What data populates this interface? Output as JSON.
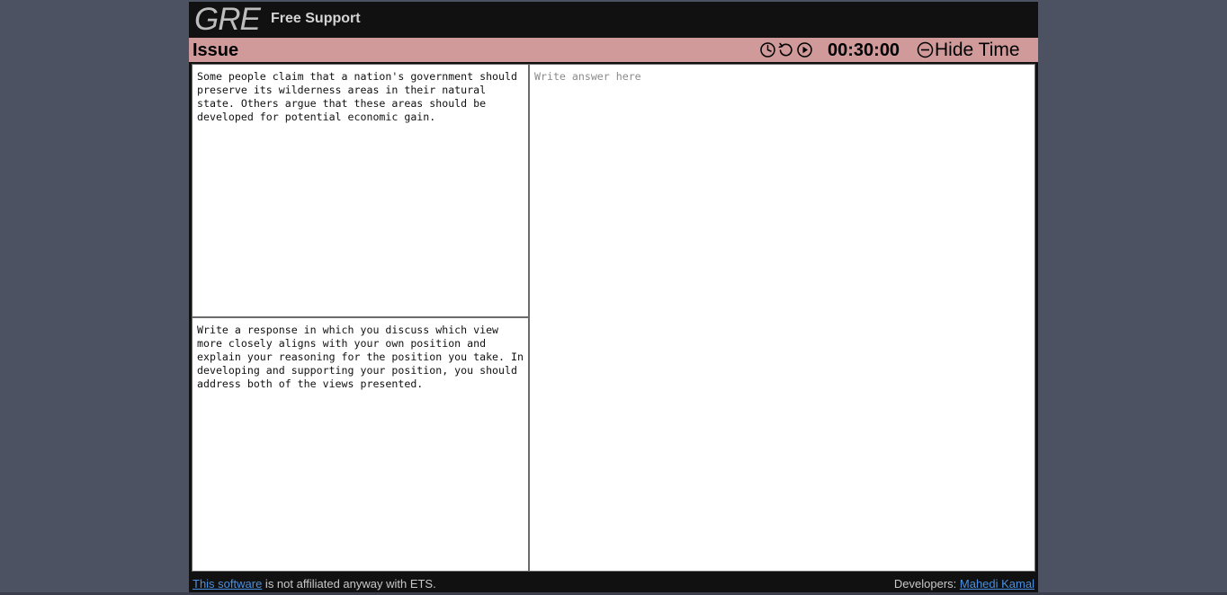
{
  "header": {
    "logo": "GRE",
    "subtitle": "Free Support"
  },
  "issue_bar": {
    "title": "Issue",
    "icons": [
      "clock-icon",
      "reset-icon",
      "play-icon",
      "minus-circle-icon"
    ],
    "timer": "00:30:00",
    "hide_time_label": "Hide Time"
  },
  "prompt": {
    "statement": "Some people claim that a nation's government should preserve its wilderness areas in their natural state. Others argue that these areas should be developed for potential economic gain.",
    "instructions": "Write a response in which you discuss which view more closely aligns with your own position and explain your reasoning for the position you take. In developing and supporting your position, you should address both of the views presented."
  },
  "answer": {
    "placeholder": "Write answer here",
    "value": ""
  },
  "footer": {
    "link_text": "This software",
    "disclaimer": " is not affiliated anyway with ETS.",
    "developers_label": "Developers: ",
    "developer_name": "Mahedi Kamal"
  },
  "colors": {
    "page_bg": "#4d5263",
    "header_bg": "#111111",
    "issue_bar_bg": "#d09a9a",
    "link": "#4a90e2"
  }
}
